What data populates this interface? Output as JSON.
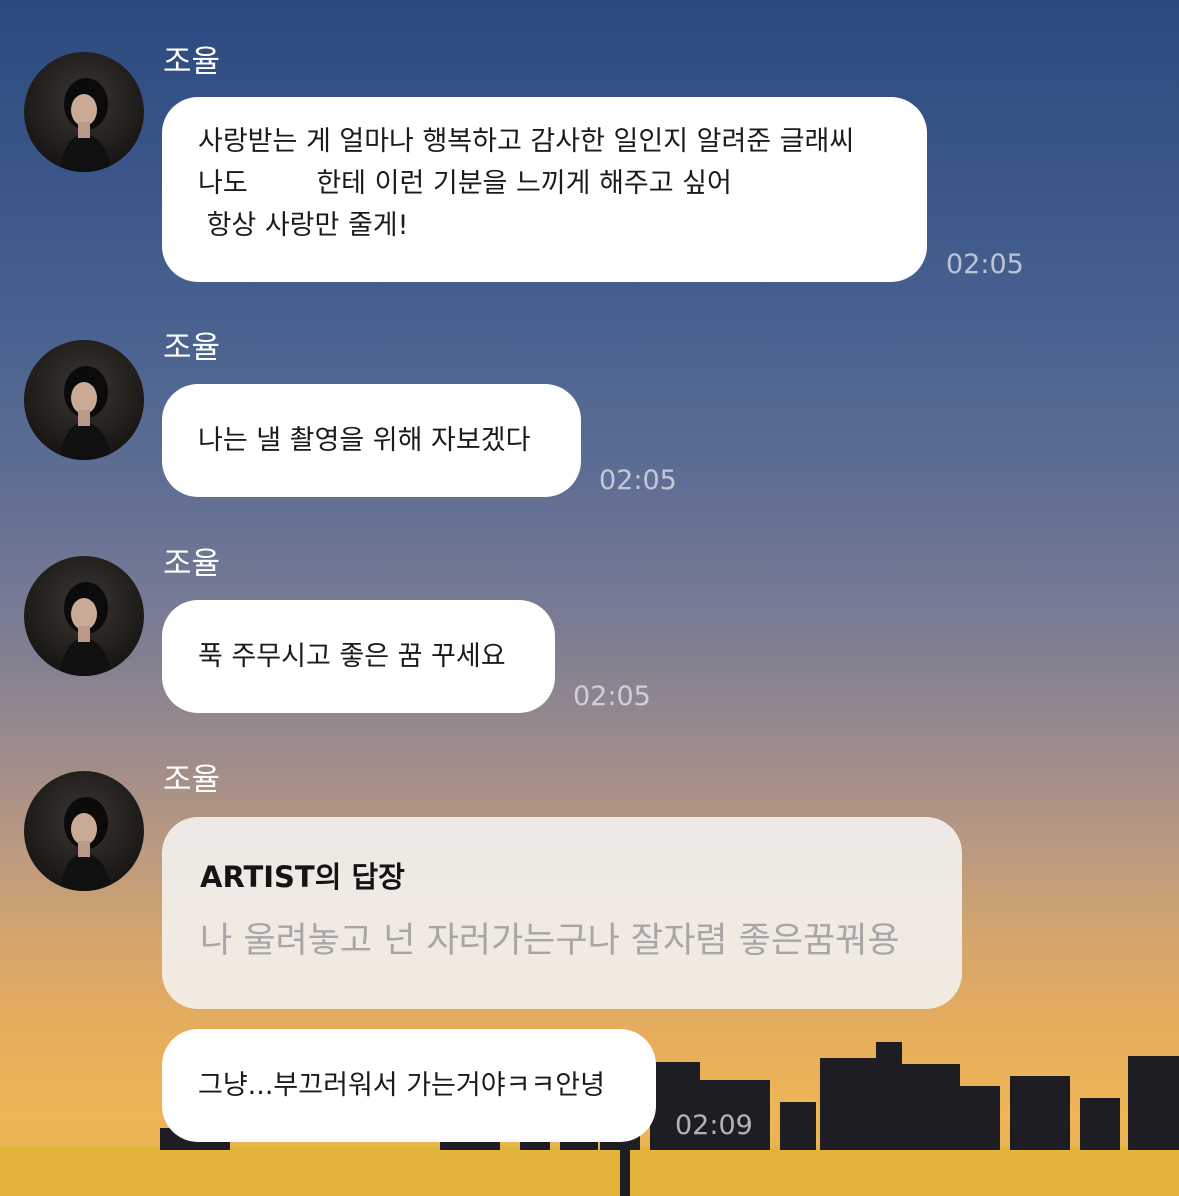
{
  "messages": [
    {
      "sender": "조율",
      "lines": [
        "사랑받는 게 얼마나 행복하고 감사한 일인지 알려준 글래씨",
        "나도        한테 이런 기분을 느끼게 해주고 싶어",
        " 항상 사랑만 줄게!"
      ],
      "time": "02:05"
    },
    {
      "sender": "조율",
      "lines": [
        "나는 낼 촬영을 위해 자보겠다"
      ],
      "time": "02:05"
    },
    {
      "sender": "조율",
      "lines": [
        "푹 주무시고 좋은 꿈 꾸세요"
      ],
      "time": "02:05"
    },
    {
      "sender": "조율",
      "reply": {
        "title": "ARTIST의 답장",
        "text": "나 울려놓고 넌 자러가는구나 잘자렴 좋은꿈꿔용"
      },
      "lines": [
        "그냥...부끄러워서 가는거야ㅋㅋ안녕"
      ],
      "time": "02:09"
    }
  ],
  "colors": {
    "bubble": "#ffffff",
    "reply_bubble": "#f4f2f0",
    "timestamp": "#ebebf0",
    "sender_name": "#ffffff"
  },
  "icons": {
    "avatar": "profile-photo"
  }
}
